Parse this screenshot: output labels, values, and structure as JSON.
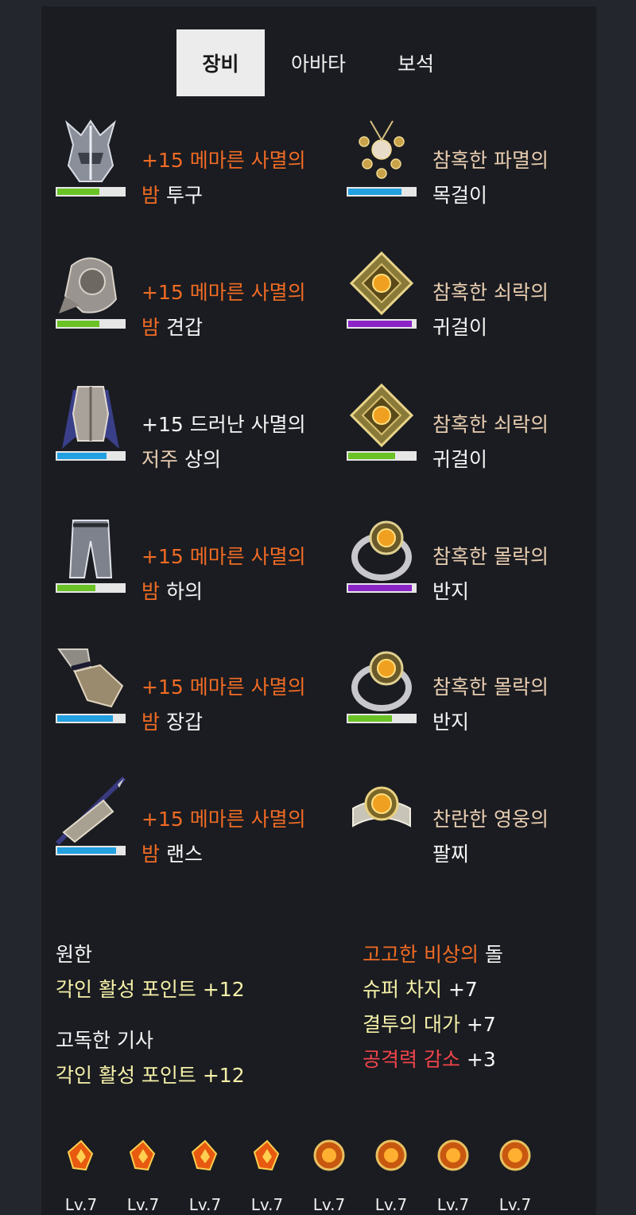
{
  "tabs": [
    "장비",
    "아바타",
    "보석"
  ],
  "equipment": {
    "left": [
      {
        "line1": "+15 메마른 사멸의",
        "line2a": "밤",
        "line2b": " 투구",
        "icon": "helmet-icon",
        "bar_color": "#6ac225",
        "bar_fill": 0.63
      },
      {
        "line1": "+15 메마른 사멸의",
        "line2a": "밤",
        "line2b": " 견갑",
        "icon": "shoulder-icon",
        "bar_color": "#6ac225",
        "bar_fill": 0.63
      },
      {
        "line1": "+15 드러난 사멸의",
        "line2a": "저주",
        "line2b": " 상의",
        "icon": "chest-icon",
        "bar_color": "#22a0e0",
        "bar_fill": 0.74
      },
      {
        "line1": "+15 메마른 사멸의",
        "line2a": "밤",
        "line2b": " 하의",
        "icon": "pants-icon",
        "bar_color": "#6ac225",
        "bar_fill": 0.57
      },
      {
        "line1": "+15 메마른 사멸의",
        "line2a": "밤",
        "line2b": " 장갑",
        "icon": "gloves-icon",
        "bar_color": "#22a0e0",
        "bar_fill": 0.83
      },
      {
        "line1": "+15 메마른 사멸의",
        "line2a": "밤",
        "line2b": " 랜스",
        "icon": "lance-icon",
        "bar_color": "#22a0e0",
        "bar_fill": 0.88
      }
    ],
    "right": [
      {
        "line1": "참혹한 파멸의",
        "line2": "목걸이",
        "icon": "necklace-icon",
        "bar_color": "#22a0e0",
        "bar_fill": 0.8
      },
      {
        "line1": "참혹한 쇠락의",
        "line2": "귀걸이",
        "icon": "earring-icon",
        "bar_color": "#8b24c7",
        "bar_fill": 0.95
      },
      {
        "line1": "참혹한 쇠락의",
        "line2": "귀걸이",
        "icon": "earring-icon",
        "bar_color": "#6ac225",
        "bar_fill": 0.7
      },
      {
        "line1": "참혹한 몰락의",
        "line2": "반지",
        "icon": "ring-icon",
        "bar_color": "#8b24c7",
        "bar_fill": 0.95
      },
      {
        "line1": "참혹한 몰락의",
        "line2": "반지",
        "icon": "ring-icon",
        "bar_color": "#6ac225",
        "bar_fill": 0.65
      },
      {
        "line1": "찬란한 영웅의",
        "line2": "팔찌",
        "icon": "bracelet-icon"
      }
    ]
  },
  "engravings": {
    "left": [
      {
        "name": "원한",
        "value": "각인 활성 포인트 +12"
      },
      {
        "name": "고독한 기사",
        "value": "각인 활성 포인트 +12"
      }
    ],
    "stone": {
      "title_colored": "고고한 비상의",
      "title_rest": " 돌",
      "lines": [
        {
          "name": "슈퍼 차지",
          "value": " +7"
        },
        {
          "name": "결투의 대가",
          "value": " +7"
        },
        {
          "name": "공격력 감소",
          "value": " +3"
        }
      ]
    }
  },
  "gems": [
    {
      "type": "flame-gem-icon",
      "level": "Lv.7"
    },
    {
      "type": "flame-gem-icon",
      "level": "Lv.7"
    },
    {
      "type": "flame-gem-icon",
      "level": "Lv.7"
    },
    {
      "type": "flame-gem-icon",
      "level": "Lv.7"
    },
    {
      "type": "round-gem-icon",
      "level": "Lv.7"
    },
    {
      "type": "round-gem-icon",
      "level": "Lv.7"
    },
    {
      "type": "round-gem-icon",
      "level": "Lv.7"
    },
    {
      "type": "round-gem-icon",
      "level": "Lv.7"
    }
  ]
}
